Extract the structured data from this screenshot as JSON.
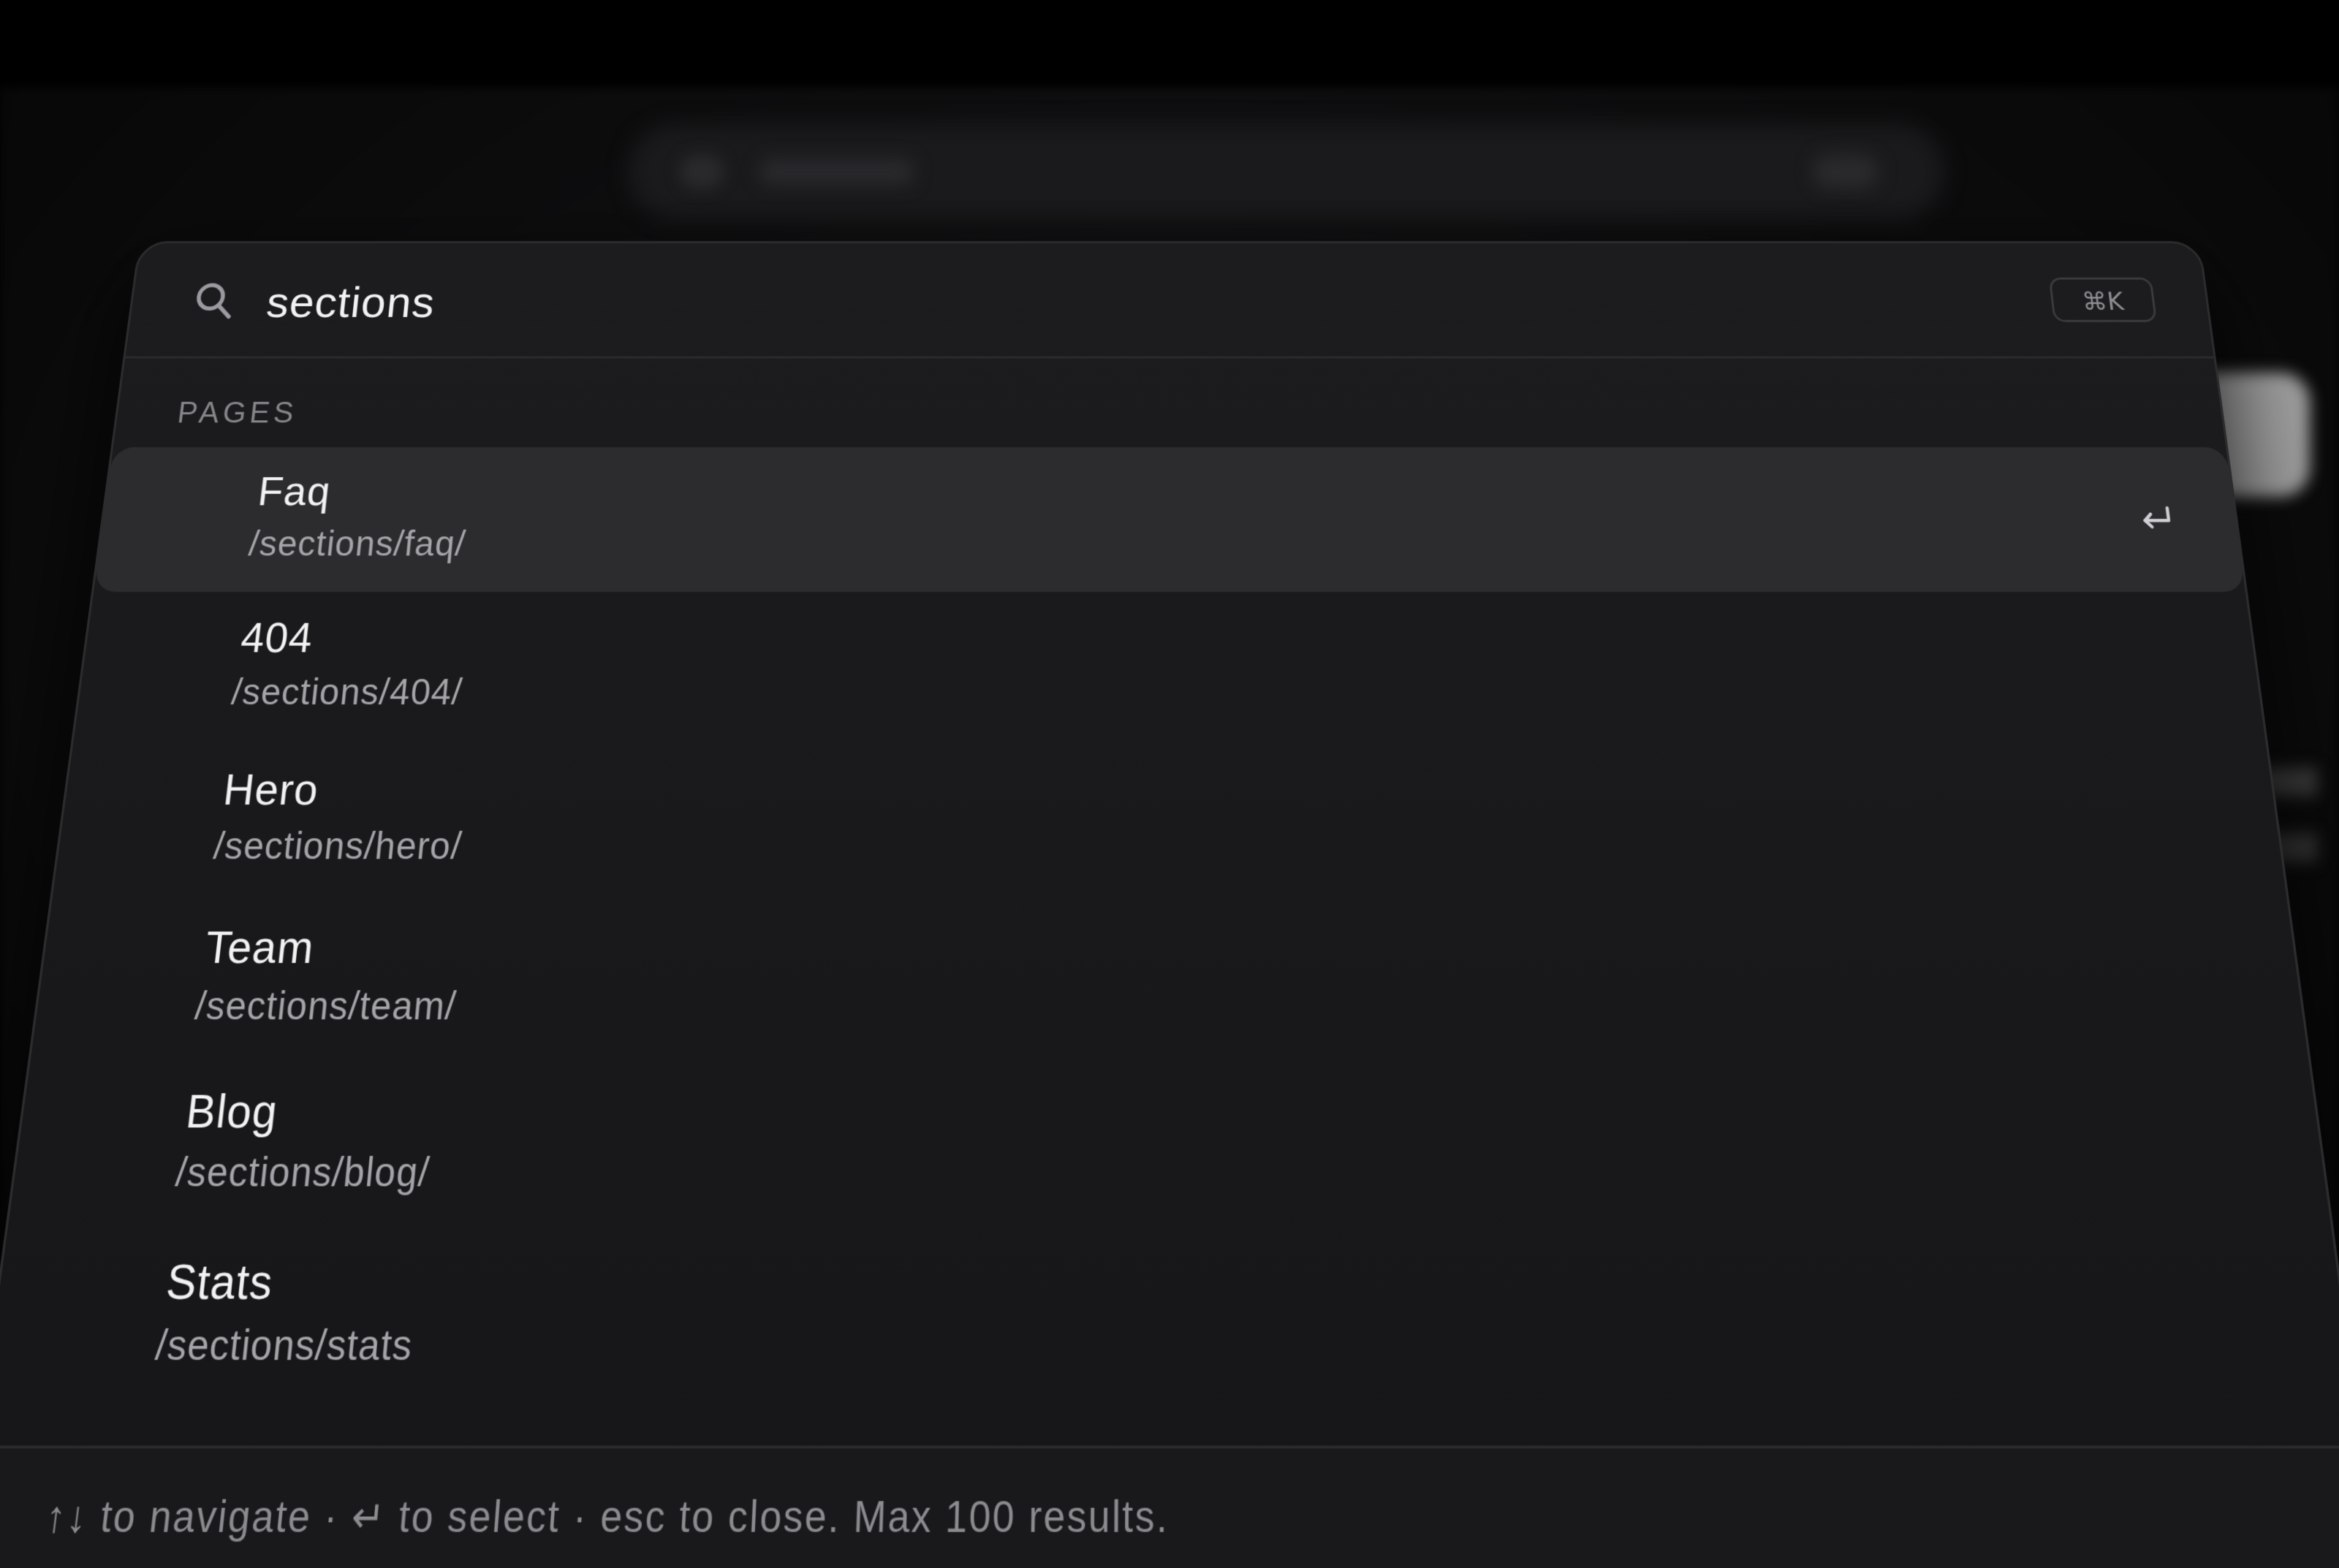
{
  "search": {
    "value": "sections",
    "shortcut": "⌘K"
  },
  "group": {
    "label": "PAGES"
  },
  "results": [
    {
      "title": "Faq",
      "path": "/sections/faq/"
    },
    {
      "title": "404",
      "path": "/sections/404/"
    },
    {
      "title": "Hero",
      "path": "/sections/hero/"
    },
    {
      "title": "Team",
      "path": "/sections/team/"
    },
    {
      "title": "Blog",
      "path": "/sections/blog/"
    },
    {
      "title": "Stats",
      "path": "/sections/stats"
    }
  ],
  "enter_glyph": "↵",
  "footer": {
    "hint": "↑↓ to navigate · ↵ to select · esc to close. Max 100 results."
  },
  "icons": {
    "search": "search-icon",
    "enter": "enter-icon"
  },
  "colors": {
    "background": "#000000",
    "panel": "#1c1c1e",
    "active_row": "#2c2c2f",
    "text_primary": "#f2f2f2",
    "text_secondary": "#a4a4a9"
  }
}
